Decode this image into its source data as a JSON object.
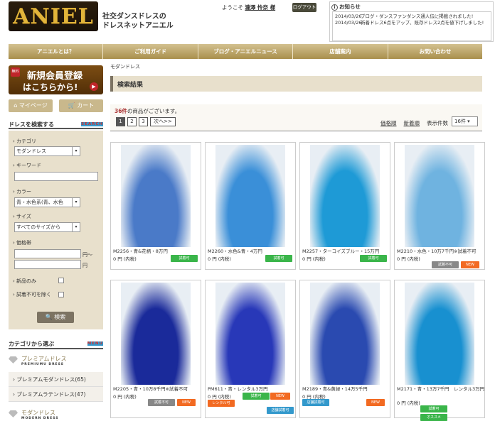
{
  "header": {
    "logo": "ANIEL",
    "tagline1": "社交ダンスドレスの",
    "tagline2": "ドレスネットアニエル",
    "welcome_prefix": "ようこそ",
    "user": "瀧澤 怜奈 様",
    "logout": "ログアウト"
  },
  "news": {
    "title": "お知らせ",
    "items": [
      {
        "date": "2014/03/26",
        "text": "ブログ・ダンスファンダンス通人伝に掲載されました!"
      },
      {
        "date": "2014/03/26",
        "text": "新着ドレス6点をアップ、既存ドレス2点を値下げしました!"
      }
    ]
  },
  "nav": [
    "アニエルとは？",
    "ご利用ガイド",
    "ブログ・アニエルニュース",
    "店舗案内",
    "お問い合わせ"
  ],
  "sidebar": {
    "register_tag": "無料",
    "register1": "新規会員登録",
    "register2": "はこちらから!",
    "mypage": "マイページ",
    "cart": "カート",
    "search_title": "ドレスを検索する",
    "search_en": "SEARCH",
    "category_label": "カテゴリ",
    "category_value": "モダンドレス",
    "keyword_label": "キーワード",
    "color_label": "カラー",
    "color_value": "青・水色系(青、水色",
    "size_label": "サイズ",
    "size_value": "すべてのサイズから",
    "price_label": "価格帯",
    "price_unit1": "円〜",
    "price_unit2": "円",
    "new_only": "新品のみ",
    "exclude_trial": "試着不可を除く",
    "search_button": "検索",
    "cat_title": "カテゴリから選ぶ",
    "cat_en": "MENU",
    "premium_title": "プレミアムドレス",
    "premium_sub": "PREMIUMU DRESS",
    "premium_items": [
      "プレミアムモダンドレス(65)",
      "プレミアムラテンドレス(47)"
    ],
    "modern_title": "モダンドレス",
    "modern_sub": "MODERN DRESS"
  },
  "main": {
    "breadcrumb": "モダンドレス",
    "result_title": "検索結果",
    "count_num": "36件",
    "count_text": "の商品がございます。",
    "pages": [
      "1",
      "2",
      "3",
      "次へ>>"
    ],
    "sort_price": "価格順",
    "sort_new": "新着順",
    "per_label": "表示件数",
    "per_value": "16件"
  },
  "products": [
    {
      "caption": "M2256・青&花柄・8万円",
      "price": "0 円 (内税)",
      "badges": [
        {
          "t": "試着可",
          "c": "g"
        }
      ],
      "color": "#4a7ac8"
    },
    {
      "caption": "M2260・水色&青・4万円",
      "price": "0 円 (内税)",
      "badges": [
        {
          "t": "試着可",
          "c": "g"
        }
      ],
      "color": "#3a8fd8"
    },
    {
      "caption": "M2257・ターコイズブルー・15万円",
      "price": "0 円 (内税)",
      "badges": [
        {
          "t": "試着可",
          "c": "g"
        }
      ],
      "color": "#1e9ad6"
    },
    {
      "caption": "M2210・水色・10万7千円※試着不可",
      "price": "0 円 (内税)",
      "badges": [
        {
          "t": "試着不可",
          "c": "gr"
        },
        {
          "t": "NEW",
          "c": "o"
        }
      ],
      "color": "#6fb3e0"
    },
    {
      "caption": "M2205・青・10万8千円※試着不可",
      "price": "0 円 (内税)",
      "badges": [
        {
          "t": "試着不可",
          "c": "gr"
        },
        {
          "t": "NEW",
          "c": "o"
        }
      ],
      "color": "#1a2a9a"
    },
    {
      "caption": "PM611・青・レンタル3万円",
      "price": "0 円 (内税)",
      "badges": [
        {
          "t": "試着可",
          "c": "g"
        },
        {
          "t": "NEW",
          "c": "o"
        },
        {
          "t": "レンタル可",
          "c": "o"
        },
        {
          "t": "店舗試着可",
          "c": "b"
        }
      ],
      "color": "#2838b8"
    },
    {
      "caption": "M2189・青&黄緑・14万5千円",
      "price": "0 円 (内税)",
      "badges": [
        {
          "t": "店舗試着可",
          "c": "b"
        },
        {
          "t": "NEW",
          "c": "o"
        }
      ],
      "color": "#2a4ab0"
    },
    {
      "caption": "M2171・青・13万7千円　レンタル3万円",
      "price": "0 円 (内税)",
      "badges": [
        {
          "t": "試着可",
          "c": "g"
        },
        {
          "t": "オススメ",
          "c": "g"
        }
      ],
      "color": "#1890d0"
    }
  ]
}
